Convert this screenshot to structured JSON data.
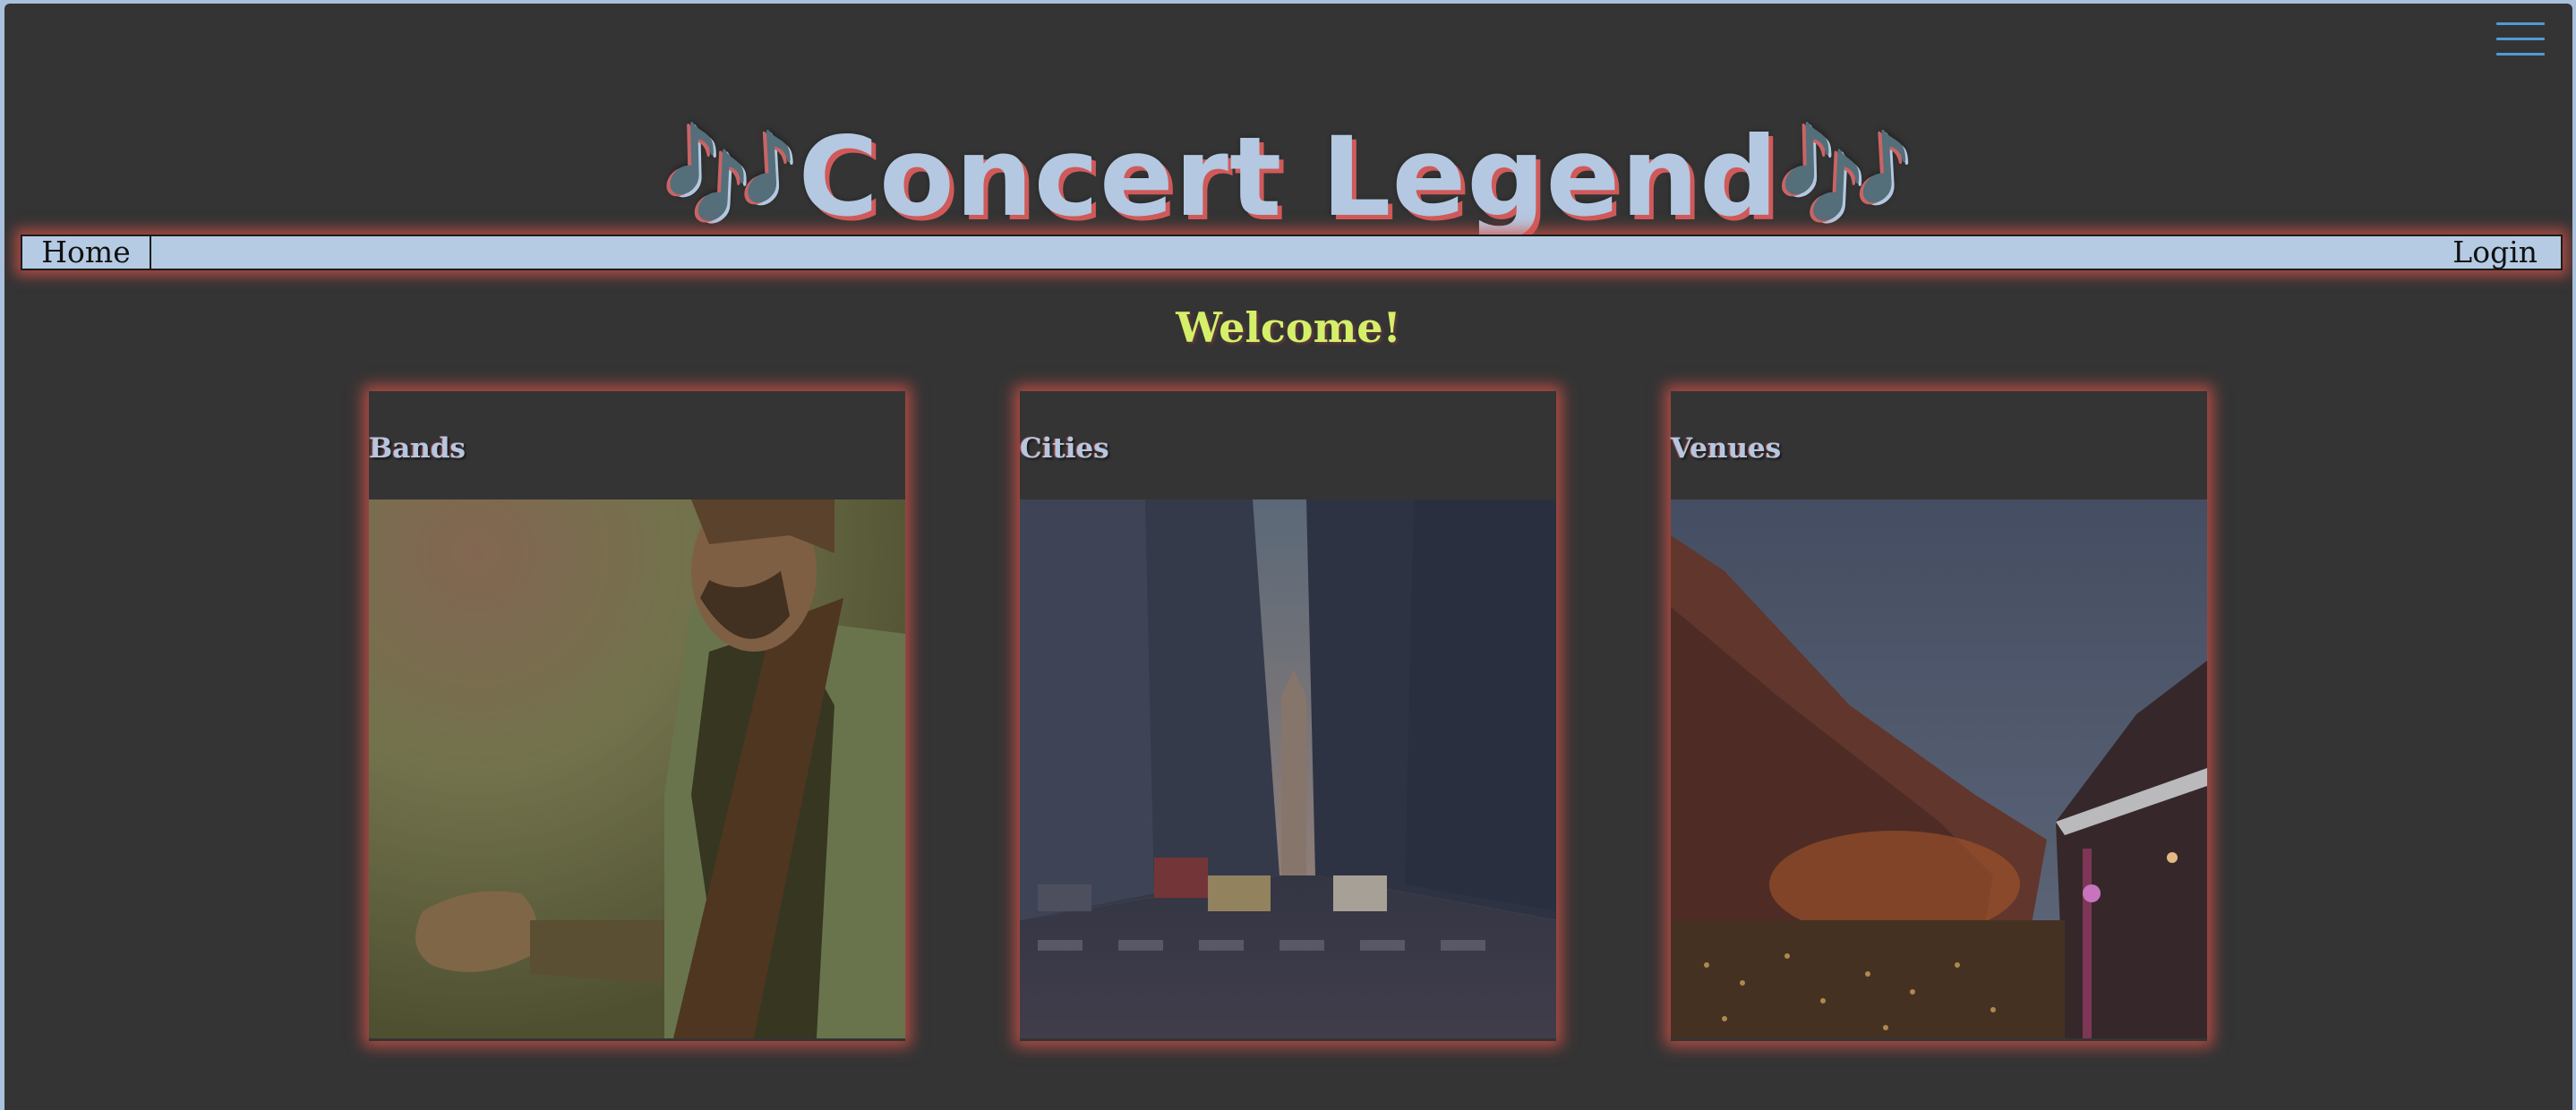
{
  "header": {
    "title": "Concert Legend",
    "title_notes": "🎶",
    "menu_icon": "hamburger-menu-icon"
  },
  "nav": {
    "home": "Home",
    "login": "Login"
  },
  "main": {
    "welcome": "Welcome!",
    "cards": [
      {
        "label": "Bands",
        "image": "guitarist-photo"
      },
      {
        "label": "Cities",
        "image": "city-street-photo"
      },
      {
        "label": "Venues",
        "image": "amphitheater-venue-photo"
      }
    ]
  },
  "colors": {
    "background": "#343434",
    "title": "#b4c8e1",
    "accent_glow": "#d65248",
    "welcome": "#d4f06a",
    "menu_icon": "#4f9bd6",
    "nav_bar": "#b5cbe3"
  }
}
